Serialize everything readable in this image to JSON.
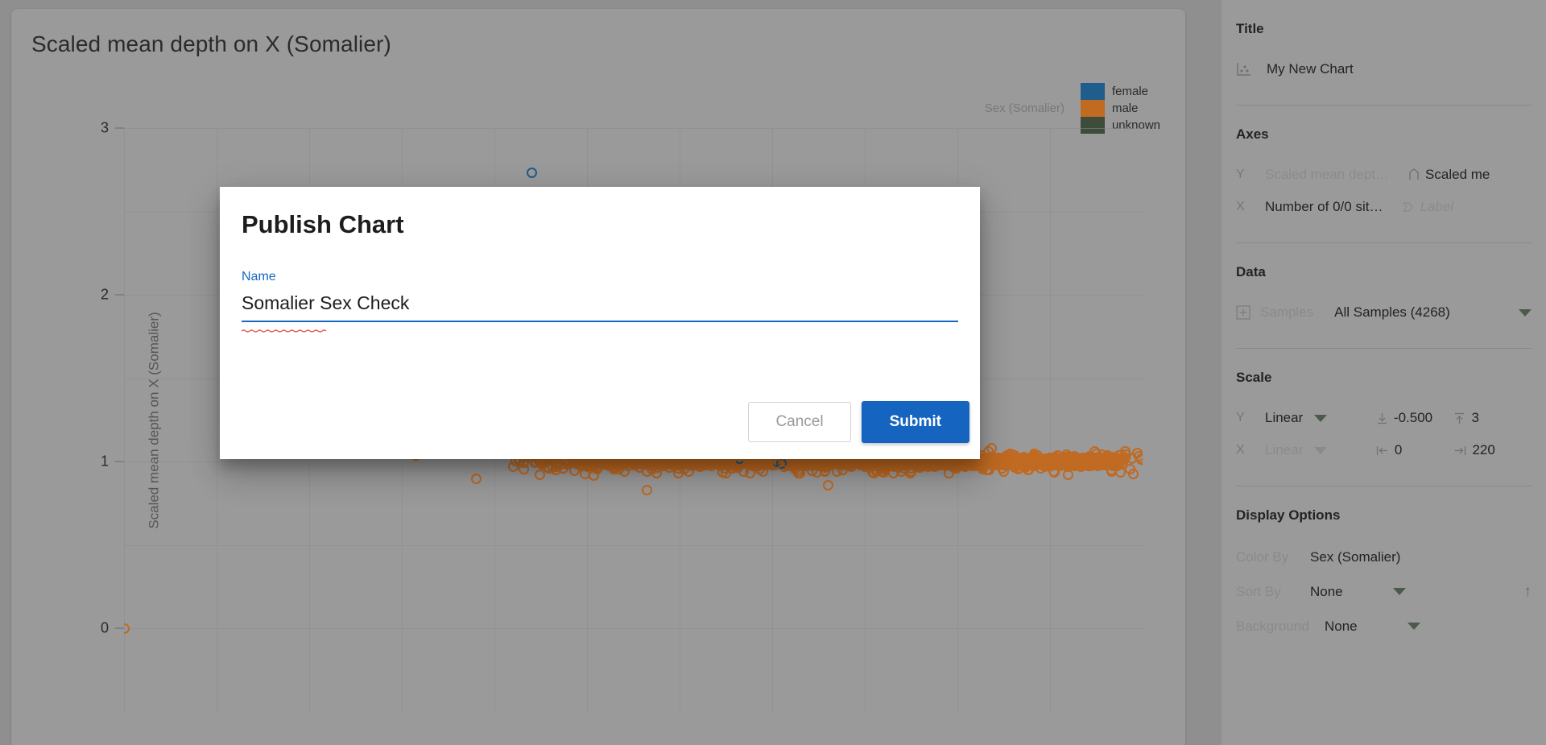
{
  "chart_panel": {
    "title": "Scaled mean depth on X (Somalier)",
    "legend": {
      "title": "Sex (Somalier)",
      "items": [
        {
          "label": "female",
          "color": "#1f5d8c"
        },
        {
          "label": "male",
          "color": "#c06a22"
        },
        {
          "label": "unknown",
          "color": "#3e4c3c"
        }
      ]
    }
  },
  "chart_data": {
    "type": "scatter",
    "title": "Scaled mean depth on X (Somalier)",
    "xlabel": "",
    "ylabel": "Scaled mean depth on X (Somalier)",
    "xlim": [
      0,
      220
    ],
    "ylim": [
      -0.5,
      3
    ],
    "yticks": [
      0,
      1,
      2,
      3
    ],
    "grid": true,
    "legend_position": "top-right",
    "color_by": "Sex (Somalier)",
    "n_samples": 4268,
    "series": [
      {
        "name": "female",
        "color": "#1f5d8c",
        "points": [
          [
            88,
            2.73
          ],
          [
            133,
            1.02
          ],
          [
            141,
            1.0
          ],
          [
            142,
            0.99
          ]
        ]
      },
      {
        "name": "male",
        "color": "#c06a22",
        "points": [
          [
            0,
            0.0
          ],
          [
            62,
            1.09
          ],
          [
            63,
            1.04
          ],
          [
            76,
            0.9
          ],
          [
            91,
            1.07
          ],
          [
            93,
            1.07
          ],
          [
            96,
            1.06
          ],
          [
            98,
            1.04
          ],
          [
            100,
            1.03
          ],
          [
            103,
            1.05
          ],
          [
            105,
            1.03
          ],
          [
            107,
            1.04
          ],
          [
            109,
            1.05
          ],
          [
            111,
            1.02
          ],
          [
            113,
            1.03
          ],
          [
            115,
            1.04
          ],
          [
            117,
            1.02
          ],
          [
            119,
            1.03
          ],
          [
            121,
            1.02
          ],
          [
            123,
            1.01
          ],
          [
            125,
            1.02
          ],
          [
            127,
            1.01
          ],
          [
            129,
            1.0
          ],
          [
            131,
            1.01
          ],
          [
            133,
            1.0
          ],
          [
            135,
            1.0
          ],
          [
            137,
            0.99
          ],
          [
            139,
            1.0
          ],
          [
            141,
            0.99
          ],
          [
            143,
            1.0
          ],
          [
            145,
            0.99
          ],
          [
            147,
            1.0
          ],
          [
            149,
            0.99
          ],
          [
            151,
            1.0
          ],
          [
            153,
            0.99
          ],
          [
            155,
            1.0
          ],
          [
            157,
            0.99
          ],
          [
            159,
            1.0
          ],
          [
            161,
            1.01
          ],
          [
            163,
            1.0
          ],
          [
            165,
            1.01
          ],
          [
            167,
            1.0
          ],
          [
            169,
            1.01
          ],
          [
            171,
            1.0
          ],
          [
            173,
            1.01
          ],
          [
            175,
            1.02
          ],
          [
            177,
            1.01
          ],
          [
            179,
            1.02
          ],
          [
            108,
            0.94
          ],
          [
            115,
            0.93
          ],
          [
            122,
            0.94
          ],
          [
            130,
            0.93
          ],
          [
            138,
            0.94
          ],
          [
            146,
            0.93
          ],
          [
            154,
            0.94
          ],
          [
            162,
            0.93
          ],
          [
            170,
            0.94
          ],
          [
            113,
            0.83
          ],
          [
            152,
            0.86
          ]
        ]
      },
      {
        "name": "unknown",
        "color": "#3e4c3c",
        "points": []
      }
    ],
    "cluster": {
      "note": "dense overlapping male markers form a solid mass near y=1",
      "x_range": [
        88,
        215
      ],
      "y_range": [
        0.93,
        1.07
      ]
    }
  },
  "sidebar": {
    "title_section": {
      "heading": "Title",
      "value": "My New Chart",
      "icon": "scatter-chart-icon"
    },
    "axes_section": {
      "heading": "Axes",
      "rows": [
        {
          "key": "Y",
          "field": "Scaled mean dept…",
          "label_icon": "bookmark-icon",
          "label_value": "Scaled me",
          "label_is_placeholder": false
        },
        {
          "key": "X",
          "field": "Number of 0/0 sit…",
          "label_icon": "label-icon",
          "label_value": "Label",
          "label_is_placeholder": true
        }
      ]
    },
    "data_section": {
      "heading": "Data",
      "samples_label": "Samples",
      "samples_value": "All Samples (4268)",
      "add_icon": "plus-box-icon"
    },
    "scale_section": {
      "heading": "Scale",
      "rows": [
        {
          "key": "Y",
          "mode": "Linear",
          "min": "-0.500",
          "max": "3",
          "min_icon": "arrow-to-bottom-icon",
          "max_icon": "arrow-to-top-icon"
        },
        {
          "key": "X",
          "mode": "Linear",
          "min": "0",
          "max": "220",
          "min_icon": "arrow-to-left-icon",
          "max_icon": "arrow-to-right-icon"
        }
      ]
    },
    "display_section": {
      "heading": "Display Options",
      "rows": [
        {
          "key": "Color By",
          "value": "Sex (Somalier)",
          "has_caret": false,
          "has_sort_arrow": false
        },
        {
          "key": "Sort By",
          "value": "None",
          "has_caret": true,
          "has_sort_arrow": true
        },
        {
          "key": "Background",
          "value": "None",
          "has_caret": true,
          "has_sort_arrow": false
        }
      ]
    }
  },
  "modal": {
    "title": "Publish Chart",
    "name_label": "Name",
    "name_value": "Somalier Sex Check",
    "name_placeholder": "Name",
    "cancel_label": "Cancel",
    "submit_label": "Submit"
  },
  "colors": {
    "accent_blue": "#1565c0",
    "panel_bg": "#9a9a9a",
    "page_bg": "#8f8f8f",
    "female": "#1f5d8c",
    "male": "#c06a22",
    "unknown": "#3e4c3c"
  }
}
